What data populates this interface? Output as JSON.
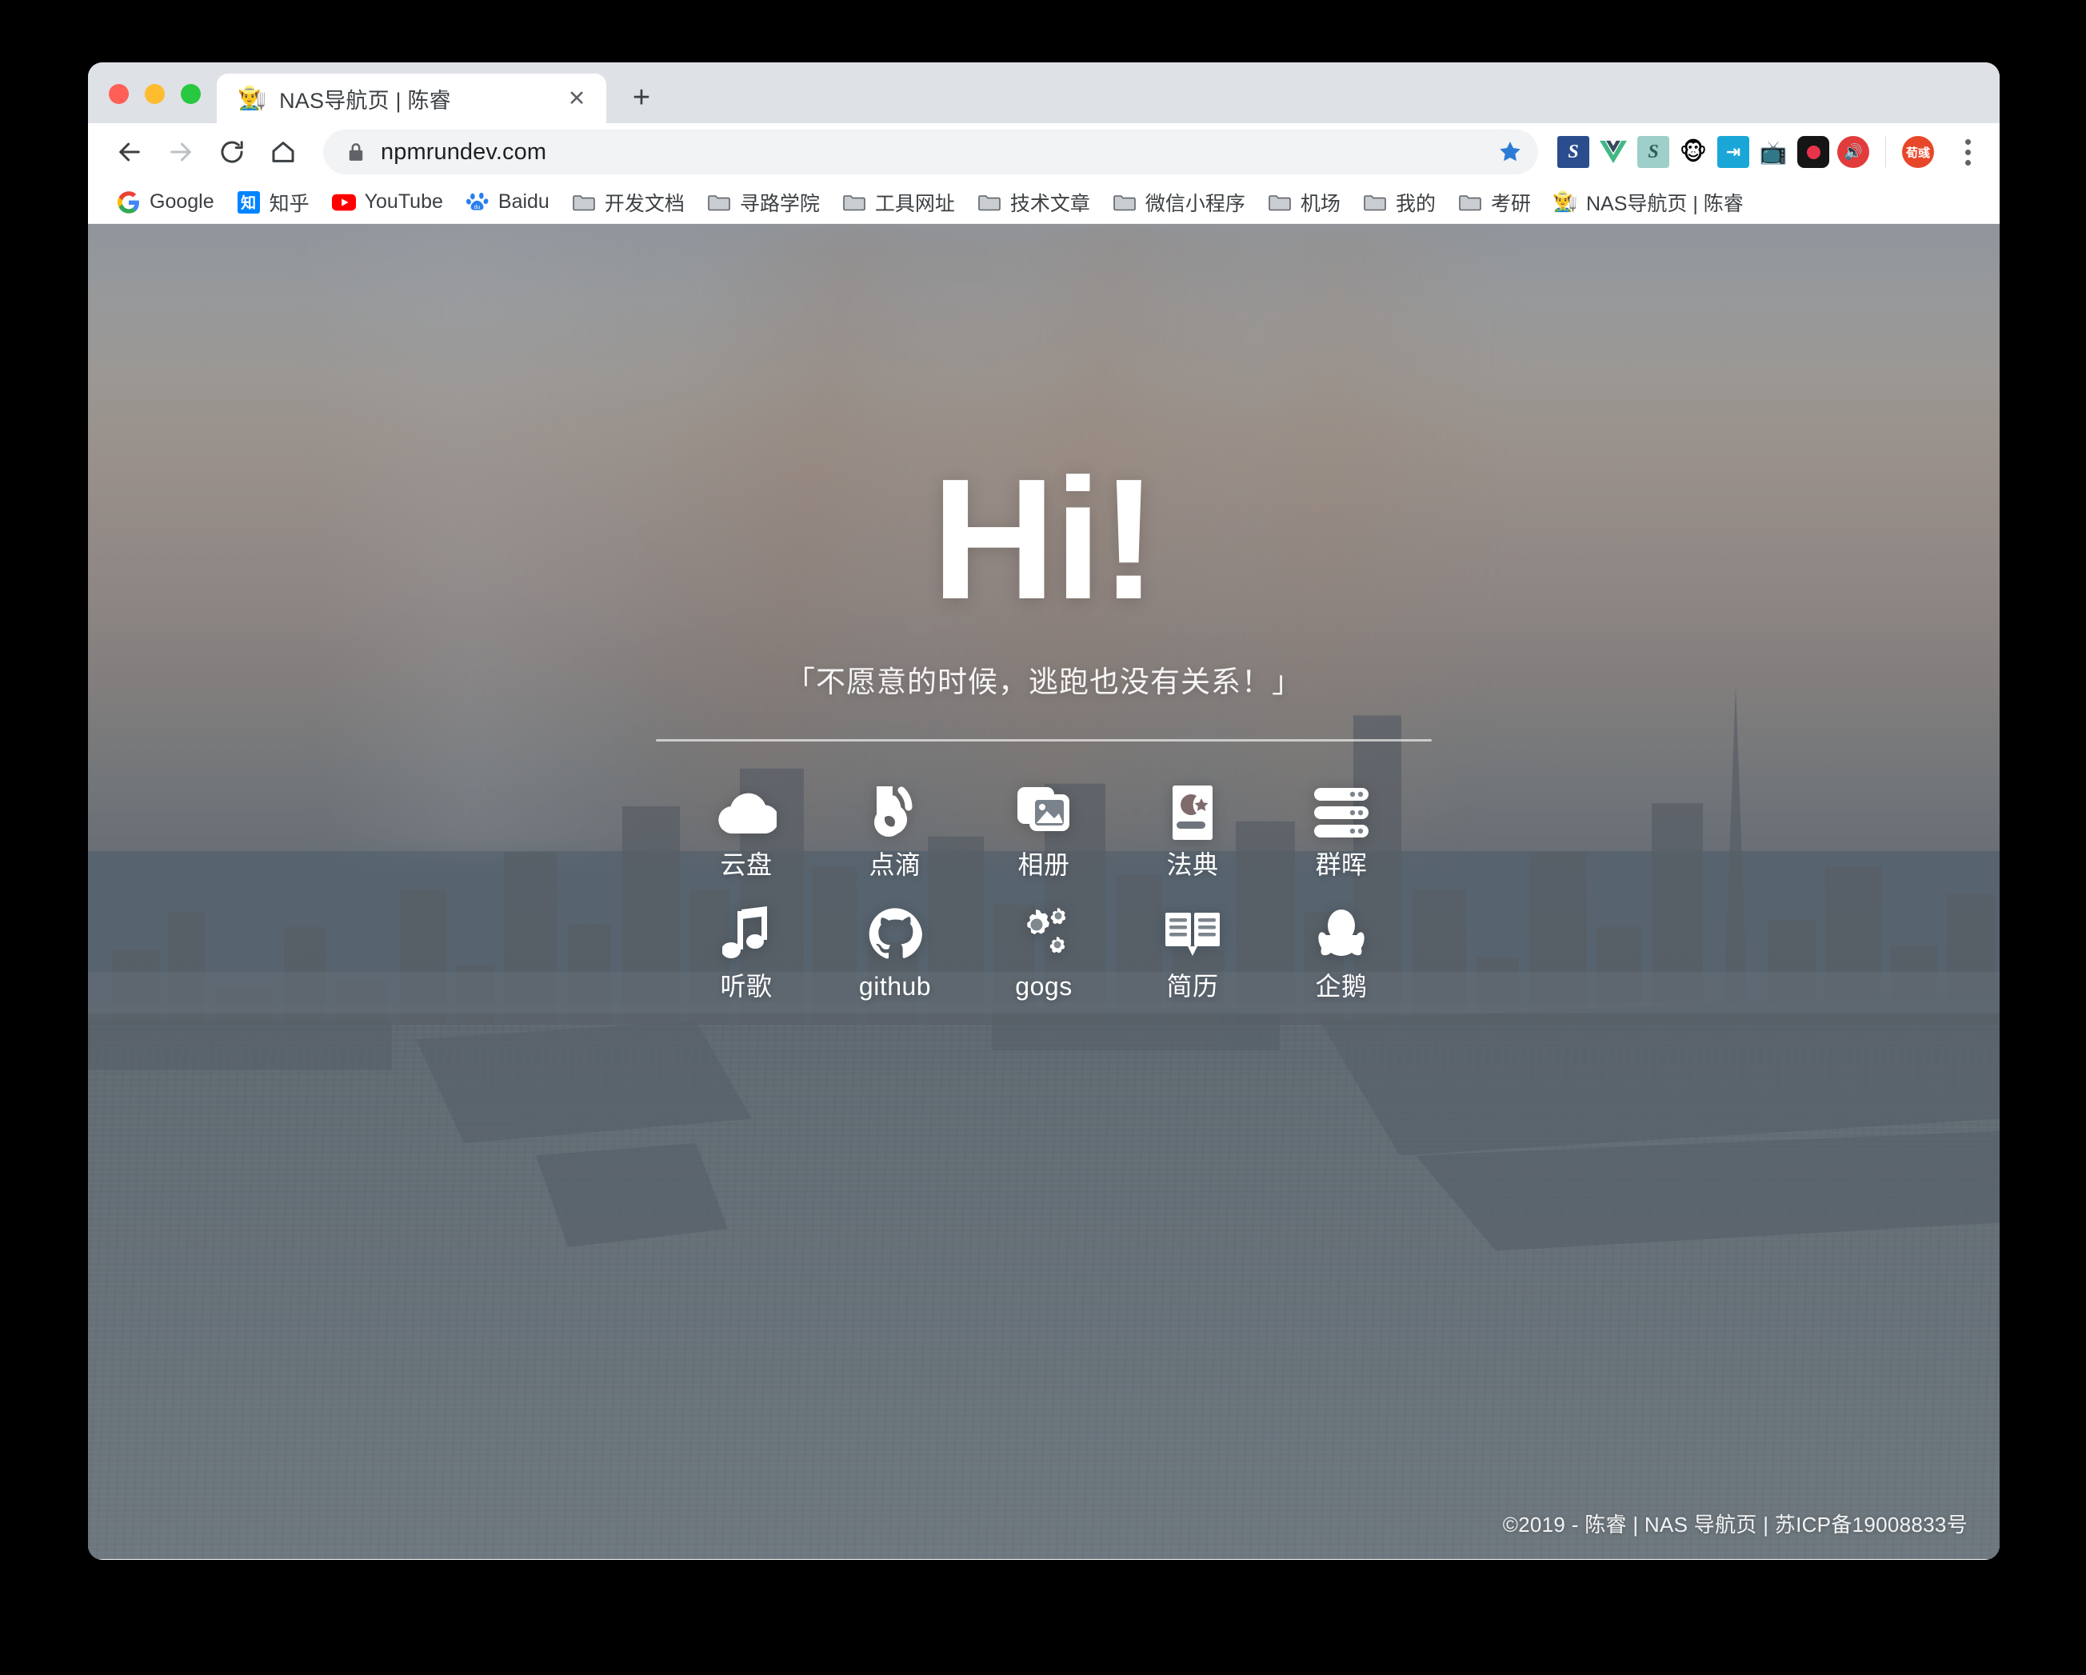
{
  "window": {
    "traffic_lights": [
      "close",
      "minimize",
      "zoom"
    ],
    "colors": {
      "close": "#ff5f57",
      "minimize": "#febc2e",
      "zoom": "#28c840",
      "chrome_bg": "#dee1e6",
      "omnibox_bg": "#f1f3f4"
    }
  },
  "tab": {
    "favicon": "👨‍🌾",
    "title": "NAS导航页 | 陈睿",
    "close_label": "✕",
    "new_tab_label": "+"
  },
  "toolbar": {
    "back_icon": "back-arrow-icon",
    "forward_icon": "forward-arrow-icon",
    "reload_icon": "reload-icon",
    "home_icon": "home-icon",
    "lock_icon": "lock-icon",
    "url": "npmrundev.com",
    "bookmark_star_icon": "star-icon",
    "menu_icon": "three-dot-menu-icon",
    "extensions": [
      {
        "name": "extension-s-blue",
        "glyph": "S",
        "color": "#ffffff",
        "bg": "#2b4d8e"
      },
      {
        "name": "extension-vue",
        "glyph": "V",
        "color": "#41b883",
        "bg": "transparent"
      },
      {
        "name": "extension-s-teal",
        "glyph": "S",
        "color": "#ffffff",
        "bg": "#8fc4bd"
      },
      {
        "name": "extension-monkey",
        "glyph": "🐵",
        "color": "#000000",
        "bg": "transparent"
      },
      {
        "name": "extension-import",
        "glyph": "⇥",
        "color": "#ffffff",
        "bg": "#1aa7d8"
      },
      {
        "name": "extension-bilibili",
        "glyph": "📺",
        "color": "#fb7299",
        "bg": "transparent"
      },
      {
        "name": "extension-recorder",
        "glyph": "◉",
        "color": "#e8334a",
        "bg": "#111111"
      },
      {
        "name": "extension-sound",
        "glyph": "🔊",
        "color": "#ffffff",
        "bg": "#e23b3b"
      }
    ],
    "profile": {
      "name": "profile-avatar",
      "label": "荀彧",
      "bg": "#e8472a"
    }
  },
  "bookmarks": [
    {
      "label": "Google",
      "icon": "google-icon",
      "type": "site"
    },
    {
      "label": "知乎",
      "icon": "zhihu-icon",
      "type": "site"
    },
    {
      "label": "YouTube",
      "icon": "youtube-icon",
      "type": "site"
    },
    {
      "label": "Baidu",
      "icon": "baidu-icon",
      "type": "site"
    },
    {
      "label": "开发文档",
      "icon": "folder-icon",
      "type": "folder"
    },
    {
      "label": "寻路学院",
      "icon": "folder-icon",
      "type": "folder"
    },
    {
      "label": "工具网址",
      "icon": "folder-icon",
      "type": "folder"
    },
    {
      "label": "技术文章",
      "icon": "folder-icon",
      "type": "folder"
    },
    {
      "label": "微信小程序",
      "icon": "folder-icon",
      "type": "folder"
    },
    {
      "label": "机场",
      "icon": "folder-icon",
      "type": "folder"
    },
    {
      "label": "我的",
      "icon": "folder-icon",
      "type": "folder"
    },
    {
      "label": "考研",
      "icon": "folder-icon",
      "type": "folder"
    },
    {
      "label": "NAS导航页 | 陈睿",
      "icon": "farmer-icon",
      "type": "site"
    }
  ],
  "page": {
    "heading": "Hi!",
    "quote": "「不愿意的时候，逃跑也没有关系！」",
    "apps_row1": [
      {
        "label": "云盘",
        "icon": "cloud-icon"
      },
      {
        "label": "点滴",
        "icon": "rss-blog-icon"
      },
      {
        "label": "相册",
        "icon": "photos-icon"
      },
      {
        "label": "法典",
        "icon": "book-crescent-icon"
      },
      {
        "label": "群晖",
        "icon": "server-icon"
      }
    ],
    "apps_row2": [
      {
        "label": "听歌",
        "icon": "music-note-icon"
      },
      {
        "label": "github",
        "icon": "github-icon"
      },
      {
        "label": "gogs",
        "icon": "gears-icon"
      },
      {
        "label": "简历",
        "icon": "open-book-icon"
      },
      {
        "label": "企鹅",
        "icon": "qq-penguin-icon"
      }
    ],
    "footer": "©2019 - 陈睿 | NAS 导航页 | 苏ICP备19008833号"
  }
}
